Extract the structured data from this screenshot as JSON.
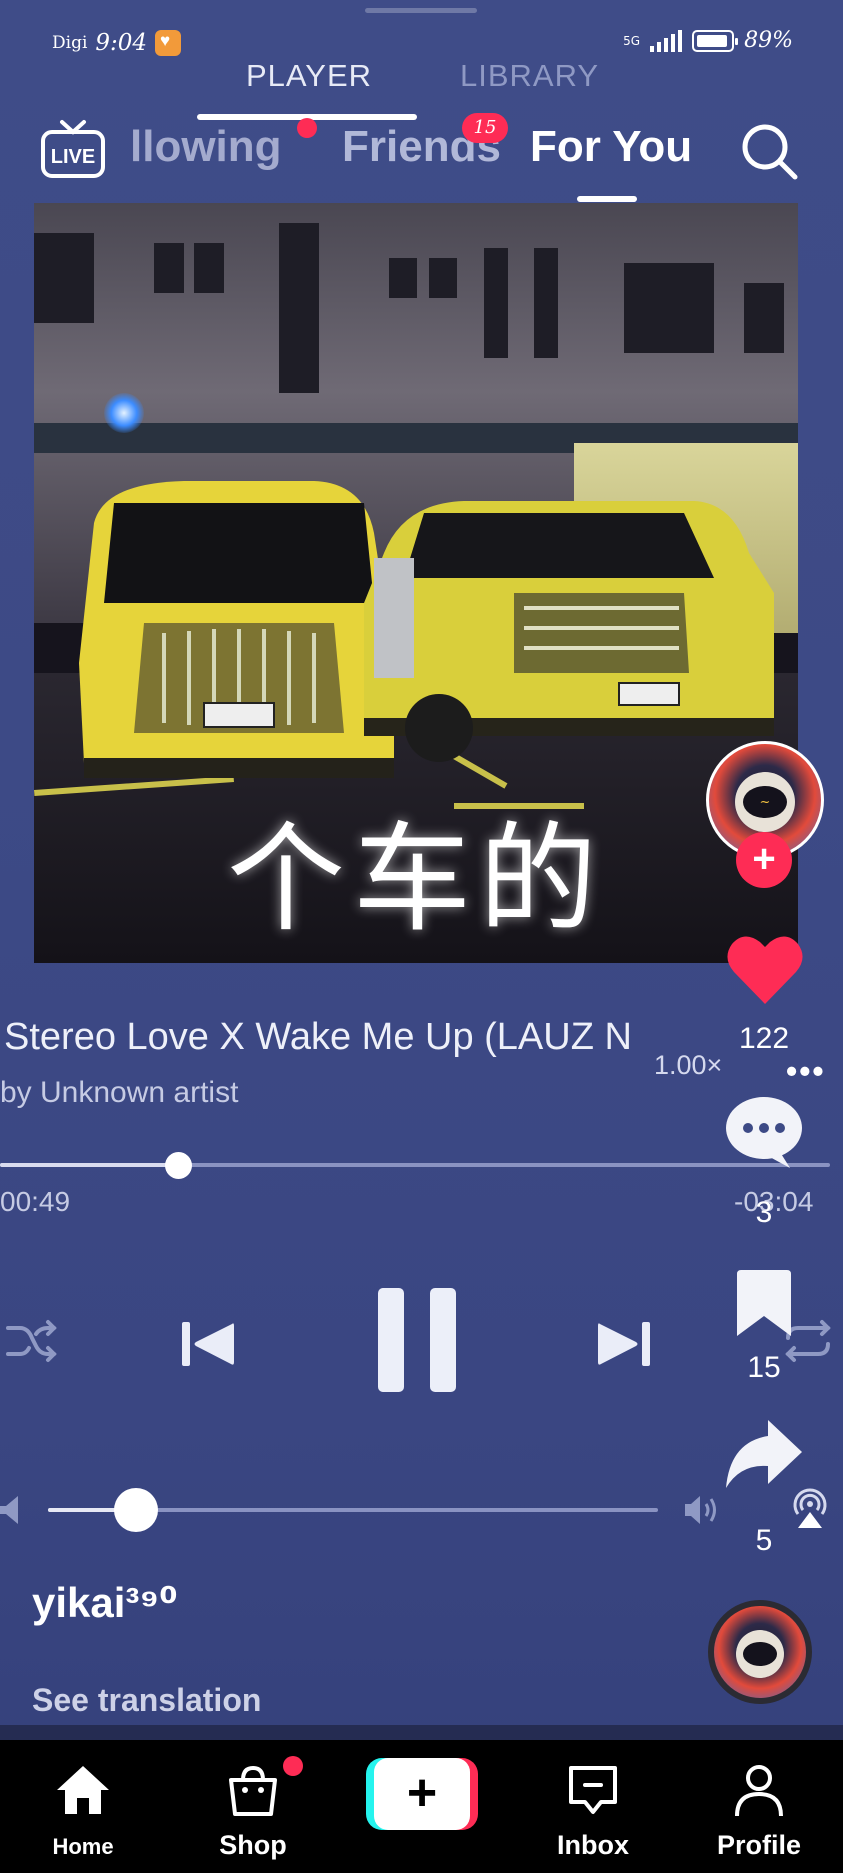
{
  "status_bar": {
    "carrier": "Digi",
    "time": "9:04",
    "network": "5G",
    "battery": "89%"
  },
  "player_tabs": {
    "player": "PLAYER",
    "library": "LIBRARY"
  },
  "top_nav": {
    "live": "LIVE",
    "following": "llowing",
    "friends": "Friends",
    "friends_badge": "15",
    "for_you": "For You"
  },
  "artwork": {
    "overlay_text": "个车的"
  },
  "song": {
    "title": "Stereo Love X Wake Me Up (LAUZ N",
    "artist": "by Unknown artist",
    "speed": "1.00×",
    "more": "•••"
  },
  "playback": {
    "elapsed": "00:49",
    "remaining": "-03:04",
    "progress_fraction": 0.21,
    "volume_fraction": 0.14,
    "state": "playing"
  },
  "actions": {
    "likes": "122",
    "comments": "3",
    "bookmarks": "15",
    "shares": "5",
    "follow": "+"
  },
  "creator": {
    "username": "yikai³⁹⁰",
    "see_translation": "See translation"
  },
  "bottom_nav": {
    "home": "Home",
    "shop": "Shop",
    "create": "+",
    "inbox": "Inbox",
    "profile": "Profile"
  },
  "colors": {
    "background": "#3d4a86",
    "accent_red": "#fe2c55",
    "accent_cyan": "#25f4ee",
    "nav_bg": "#000000"
  },
  "icons": [
    "live-icon",
    "search-icon",
    "shuffle-icon",
    "previous-icon",
    "pause-icon",
    "next-icon",
    "repeat-icon",
    "volume-low-icon",
    "volume-high-icon",
    "airplay-icon",
    "heart-icon",
    "comment-icon",
    "bookmark-icon",
    "share-icon",
    "home-icon",
    "shop-icon",
    "inbox-icon",
    "profile-icon"
  ]
}
